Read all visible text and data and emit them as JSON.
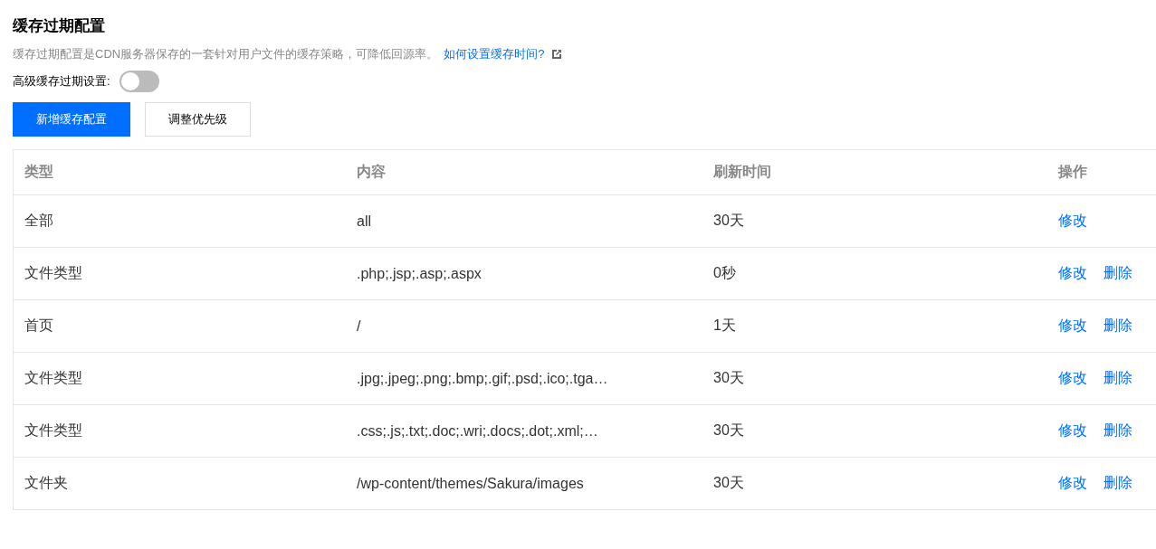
{
  "title": "缓存过期配置",
  "description": {
    "text": "缓存过期配置是CDN服务器保存的一套针对用户文件的缓存策略，可降低回源率。",
    "link": "如何设置缓存时间?"
  },
  "toggle": {
    "label": "高级缓存过期设置:",
    "on": false
  },
  "buttons": [
    {
      "label": "新增缓存配置",
      "kind": "primary"
    },
    {
      "label": "调整优先级",
      "kind": "default"
    }
  ],
  "table": {
    "columns": [
      "类型",
      "内容",
      "刷新时间",
      "操作"
    ],
    "rows": [
      {
        "type": "全部",
        "content": "all",
        "time": "30天",
        "actions": [
          "修改"
        ]
      },
      {
        "type": "文件类型",
        "content": ".php;.jsp;.asp;.aspx",
        "time": "0秒",
        "actions": [
          "修改",
          "删除"
        ]
      },
      {
        "type": "首页",
        "content": "/",
        "time": "1天",
        "actions": [
          "修改",
          "删除"
        ]
      },
      {
        "type": "文件类型",
        "content": ".jpg;.jpeg;.png;.bmp;.gif;.psd;.ico;.tga…",
        "time": "30天",
        "actions": [
          "修改",
          "删除"
        ]
      },
      {
        "type": "文件类型",
        "content": ".css;.js;.txt;.doc;.wri;.docs;.dot;.xml;…",
        "time": "30天",
        "actions": [
          "修改",
          "删除"
        ]
      },
      {
        "type": "文件夹",
        "content": "/wp-content/themes/Sakura/images",
        "time": "30天",
        "actions": [
          "修改",
          "删除"
        ]
      }
    ]
  }
}
